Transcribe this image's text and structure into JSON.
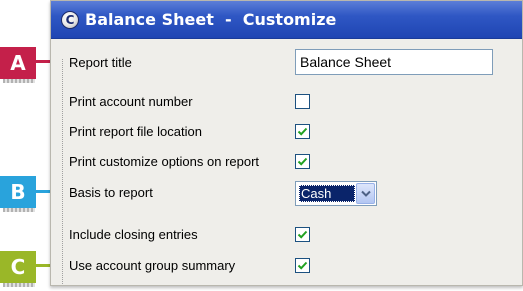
{
  "window": {
    "title": "Balance Sheet  -  Customize",
    "app_icon_glyph": "C"
  },
  "form": {
    "report_title_label": "Report title",
    "report_title_value": "Balance Sheet",
    "rows": [
      {
        "label": "Print account number",
        "checked": false
      },
      {
        "label": "Print report file location",
        "checked": true
      },
      {
        "label": "Print customize options on report",
        "checked": true
      }
    ],
    "basis_label": "Basis to report",
    "basis_value": "Cash",
    "closing_label": "Include closing entries",
    "closing_checked": true,
    "group_label": "Use account group summary",
    "group_checked": true
  },
  "callouts": {
    "a": "A",
    "b": "B",
    "c": "C",
    "colors": {
      "a": "#c4204a",
      "b": "#29a3dc",
      "c": "#9ab728"
    }
  },
  "icons": {
    "checkmark": "check-icon",
    "dropdown": "chevron-down-icon"
  }
}
